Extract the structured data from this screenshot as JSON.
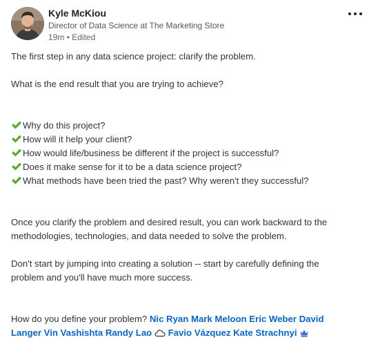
{
  "author": {
    "name": "Kyle McKiou",
    "title": "Director of Data Science at The Marketing Store",
    "time": "19m",
    "separator": "•",
    "edited": "Edited"
  },
  "post": {
    "intro": "The first step in any data science project: clarify the problem.",
    "question": "What is the end result that you are trying to achieve?",
    "checklist": [
      "Why do this project?",
      "How will it help your client?",
      "How would life/business be different if the project is successful?",
      "Does it make sense for it to be a data science project?",
      "What methods have been tried the past? Why weren't they successful?"
    ],
    "para1_line1": "Once you clarify the problem and desired result, you can work backward to the",
    "para1_line2": "methodologies, technologies, and data needed to solve the problem.",
    "para2_line1": "Don't start by jumping into creating a solution -- start by carefully defining the",
    "para2_line2": "problem and you'll have much more success.",
    "closing": "How do you define your problem?",
    "mentions": [
      "Nic Ryan",
      "Mark Meloon",
      "Eric Weber",
      "David Langer",
      "Vin Vashishta",
      "Randy Lao",
      "Favio Vázquez",
      "Kate Strachnyi"
    ]
  },
  "icons": {
    "check": "heavy-check-mark-icon",
    "cloud": "cloud-icon",
    "crown": "crown-icon",
    "more": "more-options-icon"
  },
  "colors": {
    "mention": "#0a66c2",
    "check": "#5fa830",
    "text": "#333333"
  }
}
